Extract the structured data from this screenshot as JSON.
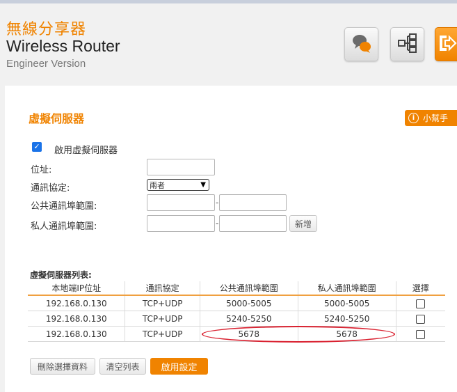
{
  "header": {
    "brand_cn": "無線分享器",
    "brand_en": "Wireless Router",
    "version": "Engineer Version",
    "icons": [
      "chat-icon",
      "network-icon",
      "logout-icon"
    ]
  },
  "section": {
    "title": "虛擬伺服器",
    "help_label": "小幫手"
  },
  "form": {
    "enable_label": "啟用虛擬伺服器",
    "enable_checked": true,
    "address_label": "位址:",
    "address_value": "",
    "protocol_label": "通訊協定:",
    "protocol_value": "兩者",
    "public_port_label": "公共通訊埠範圍:",
    "private_port_label": "私人通訊埠範圍:",
    "dash": "-",
    "add_button": "新增"
  },
  "list": {
    "title": "虛擬伺服器列表:",
    "columns": [
      "本地端IP位址",
      "通訊協定",
      "公共通訊埠範圍",
      "私人通訊埠範圍",
      "選擇"
    ],
    "rows": [
      {
        "ip": "192.168.0.130",
        "protocol": "TCP+UDP",
        "public": "5000-5005",
        "private": "5000-5005",
        "selected": false
      },
      {
        "ip": "192.168.0.130",
        "protocol": "TCP+UDP",
        "public": "5240-5250",
        "private": "5240-5250",
        "selected": false
      },
      {
        "ip": "192.168.0.130",
        "protocol": "TCP+UDP",
        "public": "5678",
        "private": "5678",
        "selected": false
      }
    ]
  },
  "actions": {
    "delete_selected": "刪除選擇資料",
    "clear_list": "清空列表",
    "apply": "啟用設定"
  },
  "colors": {
    "accent": "#f08300",
    "highlight": "#d9202f",
    "checkbox": "#1a73e8"
  }
}
